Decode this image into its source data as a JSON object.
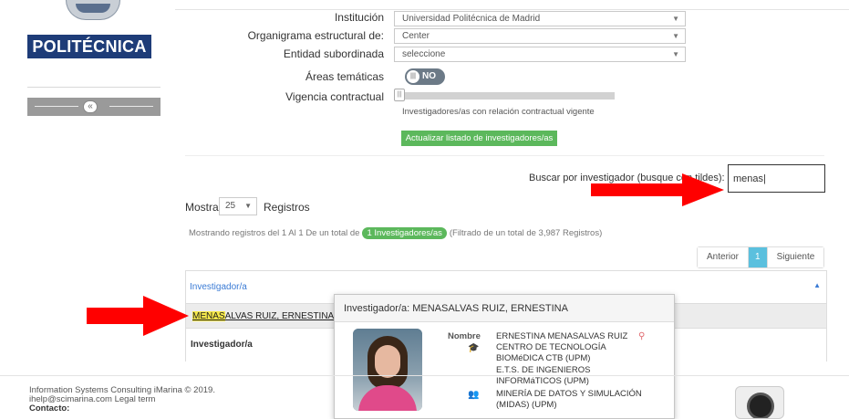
{
  "sidebar": {
    "logo_text": "POLITÉCNICA",
    "collapse_symbol": "«"
  },
  "filters": {
    "institucion": {
      "label": "Institución",
      "value": "Universidad Politécnica de Madrid"
    },
    "organigrama": {
      "label": "Organigrama estructural de:",
      "value": "Center"
    },
    "entidad": {
      "label": "Entidad subordinada",
      "value": "seleccione"
    },
    "areas": {
      "label": "Áreas temáticas",
      "toggle_text": "NO",
      "toggle_state": "off"
    },
    "vigencia": {
      "label": "Vigencia contractual",
      "hint": "Investigadores/as con relación contractual vigente"
    },
    "update_button": "Actualizar listado de investigadores/as"
  },
  "search": {
    "label": "Buscar por investigador (busque con tildes):",
    "value": "menas|"
  },
  "show": {
    "label_before": "Mostrar",
    "value": "25",
    "label_after": "Registros"
  },
  "info": {
    "prefix": "Mostrando registros del 1 Al 1 De un total de",
    "badge": "1 Investigadores/as",
    "suffix": "(Filtrado de un total de 3,987 Registros)"
  },
  "pagination": {
    "prev": "Anterior",
    "current": "1",
    "next": "Siguiente"
  },
  "table": {
    "header": "Investigador/a",
    "row_highlight": "MENAS",
    "row_rest": "ALVAS RUIZ, ERNESTINA",
    "footer": "Investigador/a"
  },
  "popup": {
    "title": "Investigador/a: MENASALVAS RUIZ, ERNESTINA",
    "nombre_label": "Nombre",
    "nombre": "ERNESTINA MENASALVAS RUIZ",
    "center_lines": [
      "CENTRO DE TECNOLOGÍA",
      "BIOMéDICA CTB (UPM)",
      "E.T.S. DE INGENIEROS",
      "INFORMáTICOS (UPM)"
    ],
    "group_lines": [
      "MINERÍA DE DATOS Y SIMULACIÓN",
      "(MIDAS) (UPM)"
    ]
  },
  "footer": {
    "line1": "Information Systems Consulting iMarina © 2019.",
    "line2": "ihelp@scimarina.com Legal term",
    "line3": "Contacto:"
  },
  "colors": {
    "accent_green": "#5cb85c",
    "accent_blue": "#5bc0de",
    "link_blue": "#3a7bd5",
    "highlight_yellow": "#f6e94a",
    "annotation_red": "#ff0000"
  },
  "icons": [
    "collapse-icon",
    "graduation-cap-icon",
    "group-icon",
    "map-pin-icon",
    "sort-up-icon",
    "dropdown-caret-icon"
  ]
}
